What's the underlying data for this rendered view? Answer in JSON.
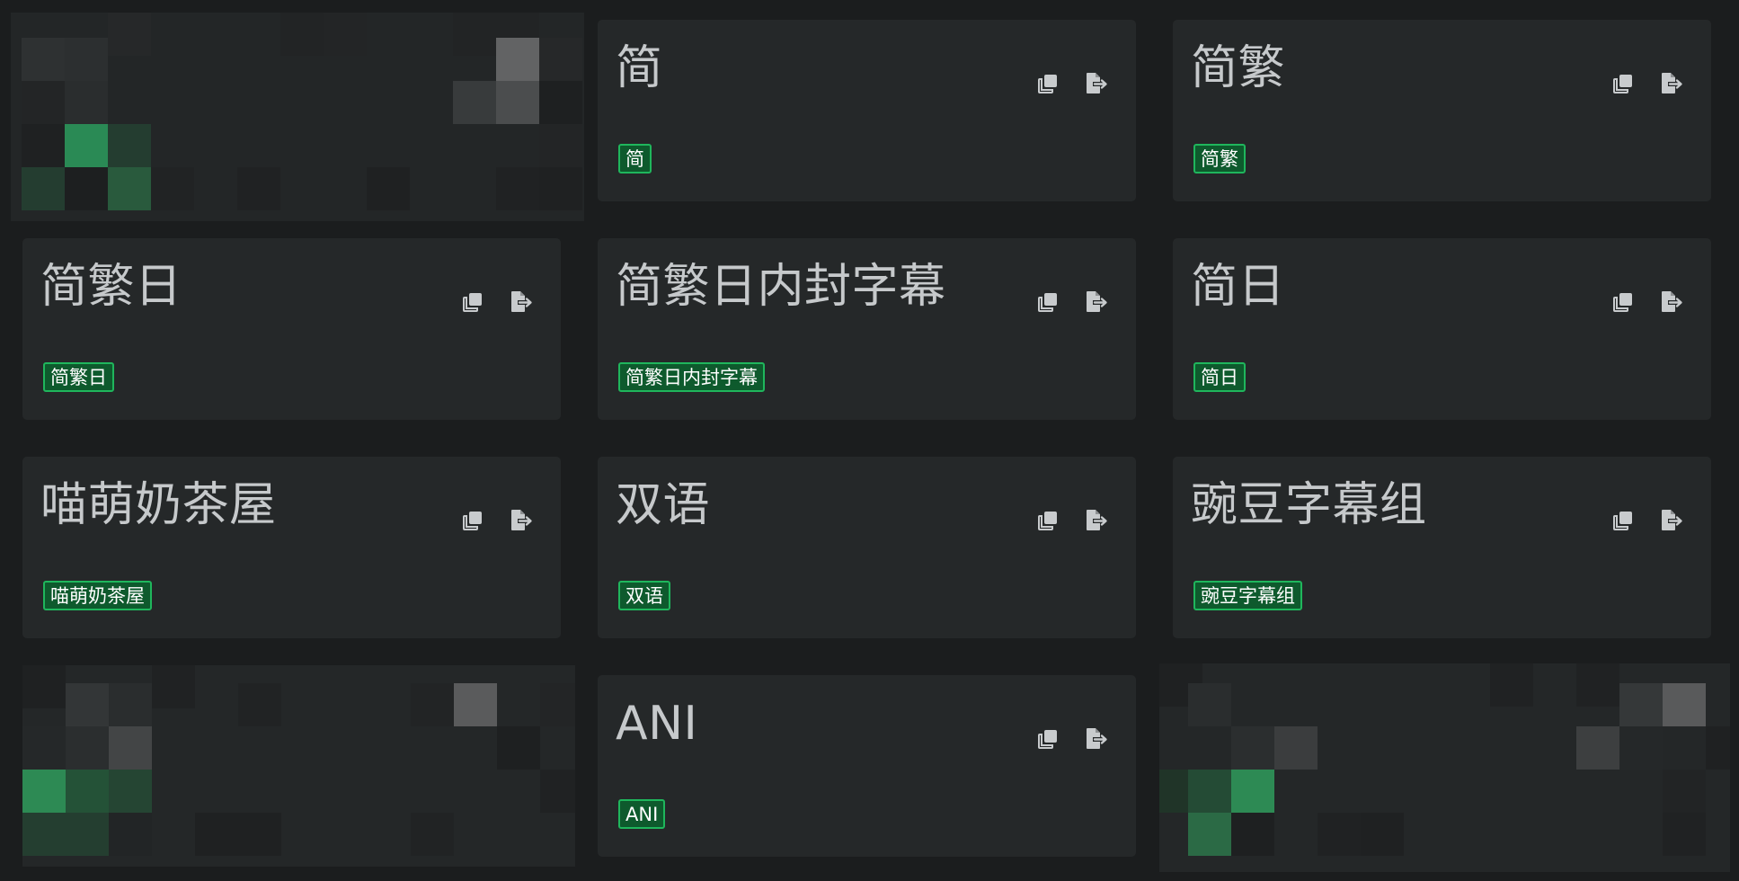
{
  "cards": [
    {
      "title": "简",
      "tag": "简"
    },
    {
      "title": "简繁",
      "tag": "简繁"
    },
    {
      "title": "简繁日",
      "tag": "简繁日"
    },
    {
      "title": "简繁日内封字幕",
      "tag": "简繁日内封字幕"
    },
    {
      "title": "简日",
      "tag": "简日"
    },
    {
      "title": "喵萌奶茶屋",
      "tag": "喵萌奶茶屋"
    },
    {
      "title": "双语",
      "tag": "双语"
    },
    {
      "title": "豌豆字幕组",
      "tag": "豌豆字幕组"
    },
    {
      "title": "ANI",
      "tag": "ANI"
    }
  ],
  "icons": {
    "copy": "copy-icon",
    "export": "file-export-icon"
  },
  "colors": {
    "page_background": "#1b1d1e",
    "card_background": "#252829",
    "title_text": "#c6c9cb",
    "tag_border": "#1fb65c",
    "tag_fill": "#0e5a2d",
    "icon": "#c8cbcd"
  }
}
